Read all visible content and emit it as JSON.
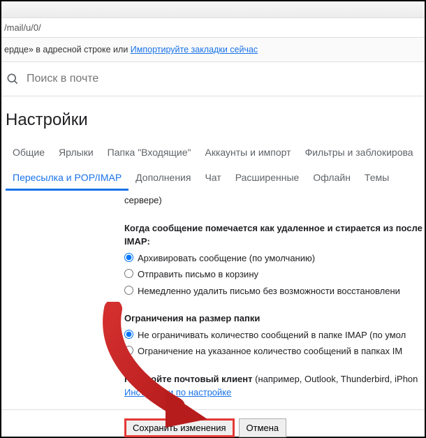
{
  "addressbar": {
    "fragment": "/mail/u/0/"
  },
  "bookmark_hint": {
    "prefix": "ердце» в адресной строке или ",
    "link": "Импортируйте закладки сейчас"
  },
  "search": {
    "placeholder": "Поиск в почте"
  },
  "title": "Настройки",
  "tabs_row1": [
    "Общие",
    "Ярлыки",
    "Папка \"Входящие\"",
    "Аккаунты и импорт",
    "Фильтры и заблокирова"
  ],
  "tabs_row2": [
    "Пересылка и POP/IMAP",
    "Дополнения",
    "Чат",
    "Расширенные",
    "Офлайн",
    "Темы"
  ],
  "active_tab": "Пересылка и POP/IMAP",
  "fragment_above": "сервере)",
  "sec_delete": {
    "heading": "Когда сообщение помечается как удаленное и стирается из после",
    "heading2": "IMAP:",
    "opts": [
      "Архивировать сообщение (по умолчанию)",
      "Отправить письмо в корзину",
      "Немедленно удалить письмо без возможности восстановлени"
    ],
    "selected": 0
  },
  "sec_limit": {
    "heading": "Ограничения на размер папки",
    "opts": [
      "Не ограничивать количество сообщений в папке IMAP (по умол",
      "Ограничение на указанное количество сообщений в папках IM"
    ],
    "selected": 0
  },
  "sec_client": {
    "heading": "Настройте почтовый клиент",
    "suffix": " (например, Outlook, Thunderbird, iPhon",
    "link": "Инструкции по настройке"
  },
  "buttons": {
    "save": "Сохранить изменения",
    "cancel": "Отмена"
  }
}
